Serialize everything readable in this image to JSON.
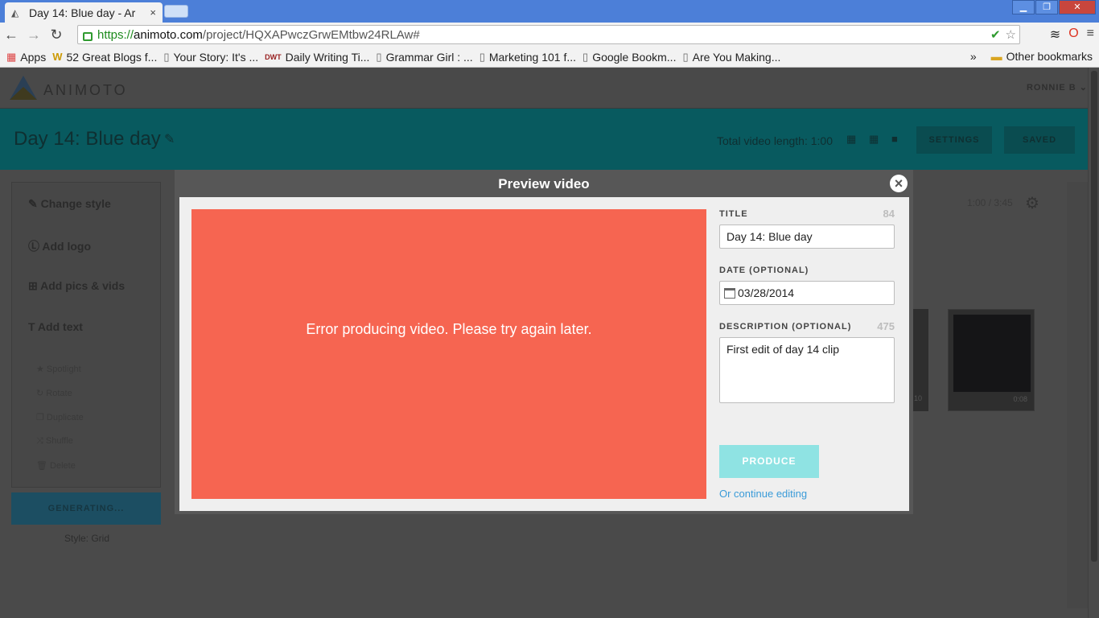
{
  "browser": {
    "tab_title": "Day 14: Blue day - Ar",
    "tab_close": "×",
    "url_scheme": "https://",
    "url_host": "animoto.com",
    "url_path": "/project/HQXAPwczGrwEMtbw24RLAw#",
    "bookmarks": [
      {
        "label": "Apps",
        "icon": "apps-grid-icon"
      },
      {
        "label": "52 Great Blogs f...",
        "icon": "w-favicon-icon"
      },
      {
        "label": "Your Story: It's ...",
        "icon": "page-icon"
      },
      {
        "label": "Daily Writing Ti...",
        "icon": "dwt-favicon-icon"
      },
      {
        "label": "Grammar Girl : ...",
        "icon": "page-icon"
      },
      {
        "label": "Marketing 101 f...",
        "icon": "page-icon"
      },
      {
        "label": "Google Bookm...",
        "icon": "page-icon"
      },
      {
        "label": "Are You Making...",
        "icon": "page-icon"
      }
    ],
    "bookmarks_overflow": "»",
    "other_bookmarks": "Other bookmarks"
  },
  "app": {
    "logo": "ANIMOTO",
    "user": "RONNIE B",
    "project_title": "Day 14: Blue day",
    "total_length": "Total video length: 1:00",
    "settings": "SETTINGS",
    "saved": "SAVED",
    "time_readout": "1:00 / 3:45",
    "sidebar": {
      "change_style": "Change style",
      "add_logo": "Add logo",
      "add_pics": "Add pics & vids",
      "add_text": "Add text",
      "spotlight": "Spotlight",
      "rotate": "Rotate",
      "duplicate": "Duplicate",
      "shuffle": "Shuffle",
      "delete": "Delete"
    },
    "generating": "GENERATING...",
    "style_label": "Style: Grid",
    "clip_duration": "0:08",
    "clip_duration_2": "10"
  },
  "modal": {
    "title": "Preview video",
    "close": "×",
    "error_message": "Error producing video. Please try again later.",
    "title_label": "TITLE",
    "title_count": "84",
    "title_value": "Day 14: Blue day",
    "date_label": "DATE (OPTIONAL)",
    "date_value": "03/28/2014",
    "desc_label": "DESCRIPTION (OPTIONAL)",
    "desc_count": "475",
    "desc_value": "First edit of day 14 clip",
    "produce": "PRODUCE",
    "continue_editing": "Or continue editing"
  },
  "colors": {
    "error_bg": "#f66551",
    "produce_bg": "#8fe3e3",
    "link": "#3a9bd8",
    "project_bar": "#085a5f"
  }
}
